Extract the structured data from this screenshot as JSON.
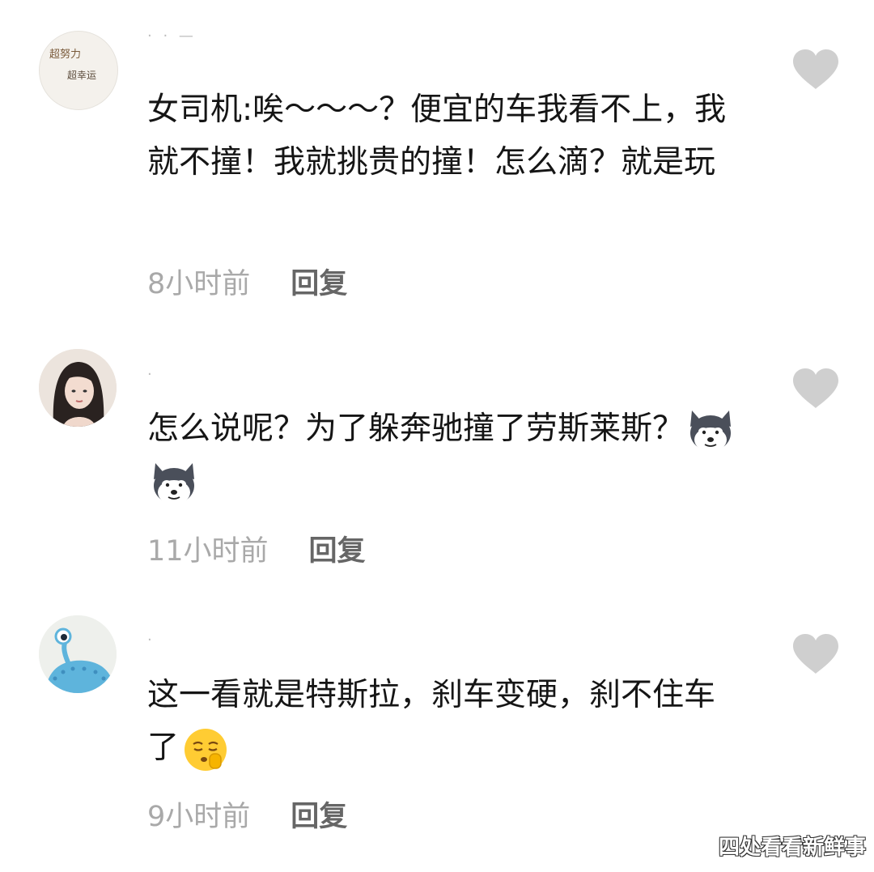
{
  "comments": [
    {
      "username": "· ·  —",
      "avatar": {
        "line1": "超努力",
        "line2": "超幸运",
        "icon": "calligraphy-avatar"
      },
      "text": "女司机:唉～～～？便宜的车我看不上，我就不撞！我就挑贵的撞！怎么滴？就是玩",
      "time": "8小时前",
      "reply_label": "回复"
    },
    {
      "username": "·",
      "avatar": {
        "icon": "girl-photo-avatar"
      },
      "text": "怎么说呢？为了躲奔驰撞了劳斯莱斯？",
      "emojis": [
        "husky-dog-emoji",
        "husky-dog-emoji"
      ],
      "time": "11小时前",
      "reply_label": "回复"
    },
    {
      "username": "·",
      "avatar": {
        "icon": "blue-alien-avatar"
      },
      "text": "这一看就是特斯拉，刹车变硬，刹不住车了",
      "emojis": [
        "shush-face-emoji"
      ],
      "time": "9小时前",
      "reply_label": "回复"
    }
  ],
  "like_icon": "heart-icon",
  "colors": {
    "heart": "#cfcfcf",
    "time": "#a9a9a9",
    "reply": "#666666",
    "text": "#151515"
  },
  "watermark": "四处看看新鲜事"
}
